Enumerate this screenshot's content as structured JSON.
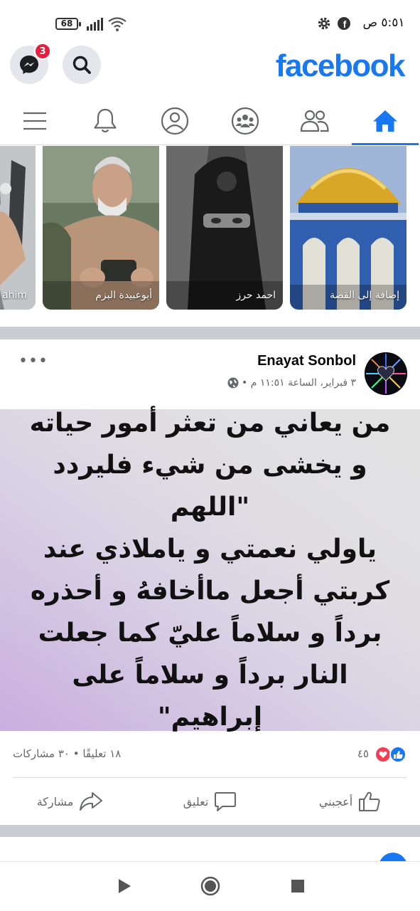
{
  "status_bar": {
    "time": "٥:٥١ ص",
    "battery": "68"
  },
  "header": {
    "logo": "facebook",
    "messenger_badge": "3"
  },
  "tabs": [
    "home",
    "friends",
    "groups",
    "profile",
    "notifications",
    "menu"
  ],
  "stories": [
    {
      "label": "إضافة إلى القصة"
    },
    {
      "label": "احمد حرز"
    },
    {
      "label": "أبوعبيدة البزم"
    },
    {
      "label": "ahim"
    }
  ],
  "post": {
    "author": "Enayat Sonbol",
    "timestamp": "٣ فبراير، الساعة ١١:٥١ م •",
    "text_lines": [
      "من يعاني من تعثر أمور حياته",
      "و يخشى من شيء فليردد \"اللهم",
      "ياولي نعمتي و ياملاذي عند",
      "كربتي أجعل ماأخافهُ و أحذره",
      "برداً و سلاماً عليّ كما جعلت",
      "النار برداً و سلاماً على إبراهيم\""
    ],
    "reactions_count": "٤٥",
    "comments_shares": "١٨ تعليقًا • ٣٠ مشاركات",
    "actions": {
      "like": "أعجبني",
      "comment": "تعليق",
      "share": "مشاركة"
    }
  },
  "colors": {
    "brand": "#1877f2",
    "badge": "#e41e3f"
  }
}
